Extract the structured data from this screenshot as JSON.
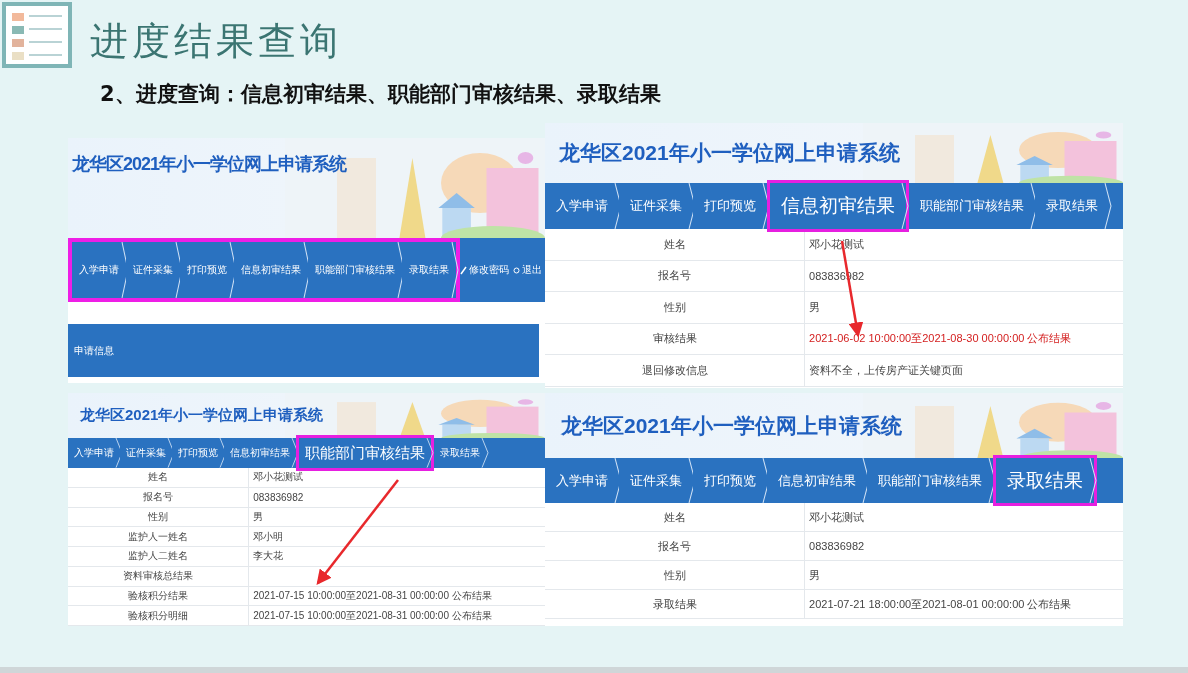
{
  "slide": {
    "title": "进度结果查询",
    "subtitle": "2、进度查询：信息初审结果、职能部门审核结果、录取结果"
  },
  "panels": [
    {
      "title": "龙华区2021年小一学位网上申请系统",
      "nav": {
        "highlighted": true,
        "tabs": [
          {
            "label": "入学申请",
            "selected": false
          },
          {
            "label": "证件采集",
            "selected": false
          },
          {
            "label": "打印预览",
            "selected": false
          },
          {
            "label": "信息初审结果",
            "selected": false
          },
          {
            "label": "职能部门审核结果",
            "selected": false
          },
          {
            "label": "录取结果",
            "selected": false
          }
        ],
        "links": [
          "修改密码",
          "退出"
        ]
      },
      "section": "申请信息",
      "arrow": false
    },
    {
      "title": "龙华区2021年小一学位网上申请系统",
      "nav": {
        "highlighted": false,
        "tabs": [
          {
            "label": "入学申请",
            "selected": false
          },
          {
            "label": "证件采集",
            "selected": false
          },
          {
            "label": "打印预览",
            "selected": false
          },
          {
            "label": "信息初审结果",
            "selected": false
          },
          {
            "label": "职能部门审核结果",
            "selected": true
          },
          {
            "label": "录取结果",
            "selected": false
          }
        ]
      },
      "rows": [
        {
          "label": "姓名",
          "value": "邓小花测试",
          "emphasis": false
        },
        {
          "label": "报名号",
          "value": "083836982",
          "emphasis": false
        },
        {
          "label": "性别",
          "value": "男",
          "emphasis": false
        },
        {
          "label": "监护人一姓名",
          "value": "邓小明",
          "emphasis": false
        },
        {
          "label": "监护人二姓名",
          "value": "李大花",
          "emphasis": false
        },
        {
          "label": "资料审核总结果"
        },
        {
          "label": "验核积分结果",
          "value": "2021-07-15 10:00:00至2021-08-31 00:00:00 公布结果",
          "emphasis": false
        },
        {
          "label": "验核积分明细",
          "value": "2021-07-15 10:00:00至2021-08-31 00:00:00 公布结果",
          "emphasis": false
        }
      ],
      "arrow": true
    },
    {
      "title": "龙华区2021年小一学位网上申请系统",
      "nav": {
        "highlighted": false,
        "tabs": [
          {
            "label": "入学申请",
            "selected": false
          },
          {
            "label": "证件采集",
            "selected": false
          },
          {
            "label": "打印预览",
            "selected": false
          },
          {
            "label": "信息初审结果",
            "selected": true
          },
          {
            "label": "职能部门审核结果",
            "selected": false
          },
          {
            "label": "录取结果",
            "selected": false
          }
        ]
      },
      "rows": [
        {
          "label": "姓名",
          "value": "邓小花测试",
          "emphasis": false
        },
        {
          "label": "报名号",
          "value": "083836982",
          "emphasis": false
        },
        {
          "label": "性别",
          "value": "男",
          "emphasis": false
        },
        {
          "label": "审核结果",
          "value": "2021-06-02 10:00:00至2021-08-30 00:00:00 公布结果",
          "emphasis": true
        },
        {
          "label": "退回修改信息",
          "value": "资料不全，上传房产证关键页面",
          "emphasis": false
        }
      ],
      "arrow": true
    },
    {
      "title": "龙华区2021年小一学位网上申请系统",
      "nav": {
        "highlighted": false,
        "tabs": [
          {
            "label": "入学申请",
            "selected": false
          },
          {
            "label": "证件采集",
            "selected": false
          },
          {
            "label": "打印预览",
            "selected": false
          },
          {
            "label": "信息初审结果",
            "selected": false
          },
          {
            "label": "职能部门审核结果",
            "selected": false
          },
          {
            "label": "录取结果",
            "selected": true
          }
        ]
      },
      "rows": [
        {
          "label": "姓名",
          "value": "邓小花测试",
          "emphasis": false
        },
        {
          "label": "报名号",
          "value": "083836982",
          "emphasis": false
        },
        {
          "label": "性别",
          "value": "男",
          "emphasis": false
        },
        {
          "label": "录取结果",
          "value": "2021-07-21 18:00:00至2021-08-01 00:00:00 公布结果",
          "emphasis": false
        }
      ],
      "arrow": false
    }
  ]
}
